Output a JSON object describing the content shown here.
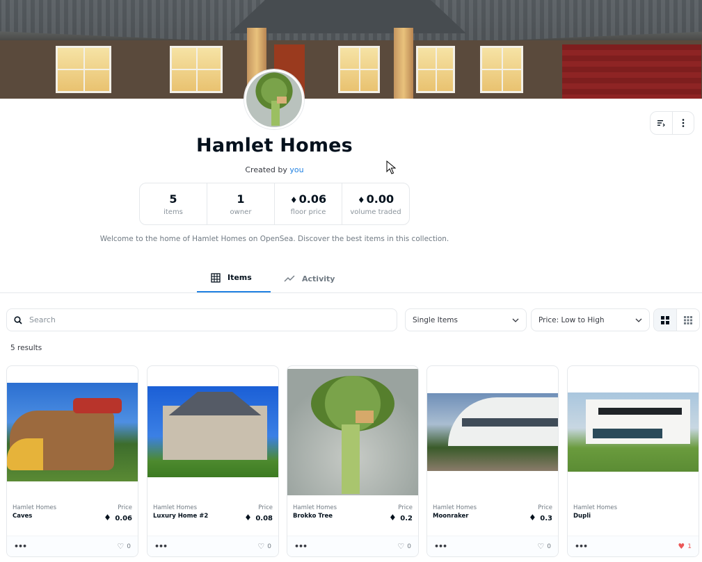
{
  "collection": {
    "name": "Hamlet Homes",
    "created_by_prefix": "Created by",
    "created_by_user": "you",
    "description": "Welcome to the home of Hamlet Homes on OpenSea. Discover the best items in this collection."
  },
  "stats": [
    {
      "value": "5",
      "label": "items",
      "eth": false
    },
    {
      "value": "1",
      "label": "owner",
      "eth": false
    },
    {
      "value": "0.06",
      "label": "floor price",
      "eth": true
    },
    {
      "value": "0.00",
      "label": "volume traded",
      "eth": true
    }
  ],
  "tabs": [
    {
      "label": "Items",
      "icon": "grid-icon",
      "active": true
    },
    {
      "label": "Activity",
      "icon": "trend-line-icon",
      "active": false
    }
  ],
  "filters": {
    "search_placeholder": "Search",
    "item_type": "Single Items",
    "sort": "Price: Low to High"
  },
  "results_text": "5 results",
  "cards": [
    {
      "collection": "Hamlet Homes",
      "name": "Caves",
      "price_label": "Price",
      "price": "0.06",
      "likes": "0",
      "liked": false
    },
    {
      "collection": "Hamlet Homes",
      "name": "Luxury Home #2",
      "price_label": "Price",
      "price": "0.08",
      "likes": "0",
      "liked": false
    },
    {
      "collection": "Hamlet Homes",
      "name": "Brokko Tree",
      "price_label": "Price",
      "price": "0.2",
      "likes": "0",
      "liked": false
    },
    {
      "collection": "Hamlet Homes",
      "name": "Moonraker",
      "price_label": "Price",
      "price": "0.3",
      "likes": "0",
      "liked": false
    },
    {
      "collection": "Hamlet Homes",
      "name": "Dupli",
      "price_label": "",
      "price": "",
      "likes": "1",
      "liked": true
    }
  ],
  "colors": {
    "accent": "#2081e2",
    "liked": "#eb5757",
    "text": "#04111d",
    "muted": "#707a83",
    "border": "#e5e8eb"
  }
}
